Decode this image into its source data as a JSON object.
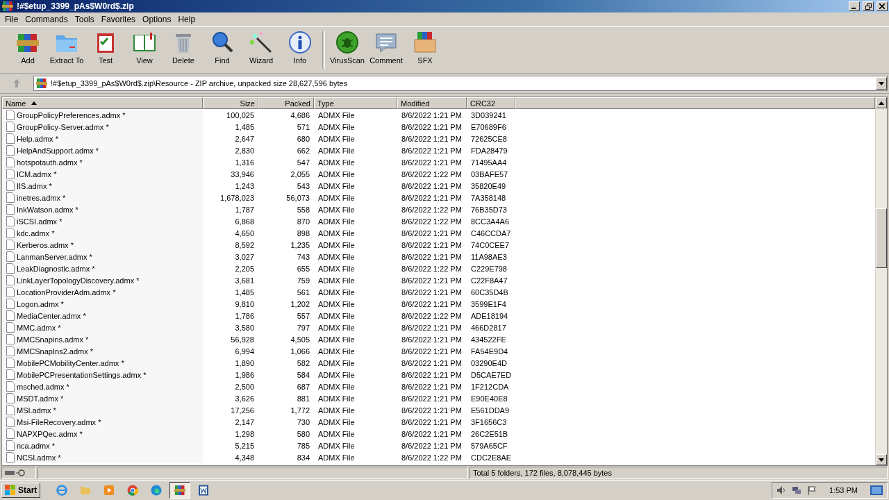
{
  "window": {
    "title": "!#$etup_3399_pAs$W0rd$.zip"
  },
  "menu": [
    "File",
    "Commands",
    "Tools",
    "Favorites",
    "Options",
    "Help"
  ],
  "toolbar": [
    {
      "label": "Add",
      "kind": "add"
    },
    {
      "label": "Extract To",
      "kind": "extract"
    },
    {
      "label": "Test",
      "kind": "test"
    },
    {
      "label": "View",
      "kind": "view"
    },
    {
      "label": "Delete",
      "kind": "delete"
    },
    {
      "label": "Find",
      "kind": "find"
    },
    {
      "label": "Wizard",
      "kind": "wizard"
    },
    {
      "label": "Info",
      "kind": "info"
    },
    {
      "label": "VirusScan",
      "kind": "virus"
    },
    {
      "label": "Comment",
      "kind": "comment"
    },
    {
      "label": "SFX",
      "kind": "sfx"
    }
  ],
  "address": "!#$etup_3399_pAs$W0rd$.zip\\Resource - ZIP archive, unpacked size 28,627,596 bytes",
  "table": {
    "columns": [
      {
        "label": "Name",
        "sorted": true
      },
      {
        "label": "Size",
        "sorted": false
      },
      {
        "label": "Packed",
        "sorted": false
      },
      {
        "label": "Type",
        "sorted": false
      },
      {
        "label": "Modified",
        "sorted": false
      },
      {
        "label": "CRC32",
        "sorted": false
      }
    ],
    "rows": [
      [
        "GroupPolicyPreferences.admx *",
        "100,025",
        "4,686",
        "ADMX File",
        "8/6/2022 1:21 PM",
        "3D039241"
      ],
      [
        "GroupPolicy-Server.admx *",
        "1,485",
        "571",
        "ADMX File",
        "8/6/2022 1:21 PM",
        "E70689F6"
      ],
      [
        "Help.admx *",
        "2,647",
        "680",
        "ADMX File",
        "8/6/2022 1:21 PM",
        "72625CE8"
      ],
      [
        "HelpAndSupport.admx *",
        "2,830",
        "662",
        "ADMX File",
        "8/6/2022 1:21 PM",
        "FDA28479"
      ],
      [
        "hotspotauth.admx *",
        "1,316",
        "547",
        "ADMX File",
        "8/6/2022 1:21 PM",
        "71495AA4"
      ],
      [
        "ICM.admx *",
        "33,946",
        "2,055",
        "ADMX File",
        "8/6/2022 1:22 PM",
        "03BAFE57"
      ],
      [
        "IIS.admx *",
        "1,243",
        "543",
        "ADMX File",
        "8/6/2022 1:21 PM",
        "35820E49"
      ],
      [
        "inetres.admx *",
        "1,678,023",
        "56,073",
        "ADMX File",
        "8/6/2022 1:21 PM",
        "7A358148"
      ],
      [
        "InkWatson.admx *",
        "1,787",
        "558",
        "ADMX File",
        "8/6/2022 1:22 PM",
        "76B35D73"
      ],
      [
        "iSCSI.admx *",
        "6,868",
        "870",
        "ADMX File",
        "8/6/2022 1:22 PM",
        "8CC3A4A6"
      ],
      [
        "kdc.admx *",
        "4,650",
        "898",
        "ADMX File",
        "8/6/2022 1:21 PM",
        "C46CCDA7"
      ],
      [
        "Kerberos.admx *",
        "8,592",
        "1,235",
        "ADMX File",
        "8/6/2022 1:21 PM",
        "74C0CEE7"
      ],
      [
        "LanmanServer.admx *",
        "3,027",
        "743",
        "ADMX File",
        "8/6/2022 1:21 PM",
        "11A98AE3"
      ],
      [
        "LeakDiagnostic.admx *",
        "2,205",
        "655",
        "ADMX File",
        "8/6/2022 1:22 PM",
        "C229E798"
      ],
      [
        "LinkLayerTopologyDiscovery.admx *",
        "3,681",
        "759",
        "ADMX File",
        "8/6/2022 1:21 PM",
        "C22F8A47"
      ],
      [
        "LocationProviderAdm.admx *",
        "1,485",
        "561",
        "ADMX File",
        "8/6/2022 1:21 PM",
        "60C35D4B"
      ],
      [
        "Logon.admx *",
        "9,810",
        "1,202",
        "ADMX File",
        "8/6/2022 1:21 PM",
        "3599E1F4"
      ],
      [
        "MediaCenter.admx *",
        "1,786",
        "557",
        "ADMX File",
        "8/6/2022 1:22 PM",
        "ADE18194"
      ],
      [
        "MMC.admx *",
        "3,580",
        "797",
        "ADMX File",
        "8/6/2022 1:21 PM",
        "466D2817"
      ],
      [
        "MMCSnapins.admx *",
        "56,928",
        "4,505",
        "ADMX File",
        "8/6/2022 1:21 PM",
        "434522FE"
      ],
      [
        "MMCSnapIns2.admx *",
        "6,994",
        "1,066",
        "ADMX File",
        "8/6/2022 1:21 PM",
        "FA54E9D4"
      ],
      [
        "MobilePCMobilityCenter.admx *",
        "1,890",
        "582",
        "ADMX File",
        "8/6/2022 1:21 PM",
        "03290E4D"
      ],
      [
        "MobilePCPresentationSettings.admx *",
        "1,986",
        "584",
        "ADMX File",
        "8/6/2022 1:21 PM",
        "D5CAE7ED"
      ],
      [
        "msched.admx *",
        "2,500",
        "687",
        "ADMX File",
        "8/6/2022 1:21 PM",
        "1F212CDA"
      ],
      [
        "MSDT.admx *",
        "3,626",
        "881",
        "ADMX File",
        "8/6/2022 1:21 PM",
        "E90E40E8"
      ],
      [
        "MSI.admx *",
        "17,256",
        "1,772",
        "ADMX File",
        "8/6/2022 1:21 PM",
        "E561DDA9"
      ],
      [
        "Msi-FileRecovery.admx *",
        "2,147",
        "730",
        "ADMX File",
        "8/6/2022 1:21 PM",
        "3F1656C3"
      ],
      [
        "NAPXPQec.admx *",
        "1,298",
        "580",
        "ADMX File",
        "8/6/2022 1:21 PM",
        "26C2E51B"
      ],
      [
        "nca.admx *",
        "5,215",
        "785",
        "ADMX File",
        "8/6/2022 1:21 PM",
        "579A65CF"
      ],
      [
        "NCSI.admx *",
        "4,348",
        "834",
        "ADMX File",
        "8/6/2022 1:22 PM",
        "CDC2E8AE"
      ]
    ]
  },
  "status_bar": "Total 5 folders, 172 files, 8,078,445 bytes",
  "taskbar": {
    "start": "Start",
    "apps": [
      {
        "kind": "ie",
        "selected": false
      },
      {
        "kind": "folder",
        "selected": false
      },
      {
        "kind": "media",
        "selected": false
      },
      {
        "kind": "chrome",
        "selected": false
      },
      {
        "kind": "edge",
        "selected": false
      },
      {
        "kind": "winrar",
        "selected": true
      },
      {
        "kind": "word",
        "selected": false
      }
    ],
    "clock": "1:53 PM"
  }
}
